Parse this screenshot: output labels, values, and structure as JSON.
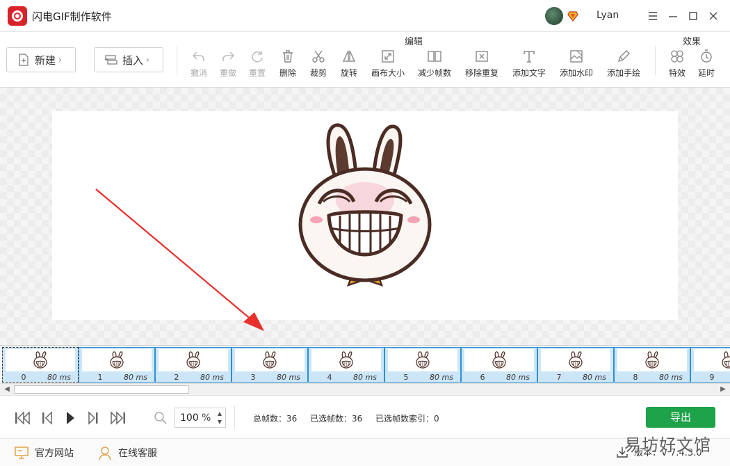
{
  "window": {
    "title": "闪电GIF制作软件",
    "username": "Lyan"
  },
  "toolbar": {
    "new_label": "新建",
    "insert_label": "插入",
    "edit_group_label": "编辑",
    "effects_group_label": "效果",
    "tools": [
      {
        "label": "撤消",
        "icon": "undo-icon",
        "enabled": false
      },
      {
        "label": "重做",
        "icon": "redo-icon",
        "enabled": false
      },
      {
        "label": "重置",
        "icon": "reset-icon",
        "enabled": false
      },
      {
        "label": "删除",
        "icon": "trash-icon",
        "enabled": true
      },
      {
        "label": "裁剪",
        "icon": "scissors-icon",
        "enabled": true
      },
      {
        "label": "旋转",
        "icon": "flip-icon",
        "enabled": true
      },
      {
        "label": "画布大小",
        "icon": "canvas-resize-icon",
        "enabled": true
      },
      {
        "label": "减少帧数",
        "icon": "reduce-frames-icon",
        "enabled": true
      },
      {
        "label": "移除重复",
        "icon": "remove-duplicate-icon",
        "enabled": true
      },
      {
        "label": "添加文字",
        "icon": "text-icon",
        "enabled": true
      },
      {
        "label": "添加水印",
        "icon": "watermark-icon",
        "enabled": true
      },
      {
        "label": "添加手绘",
        "icon": "pen-icon",
        "enabled": true
      }
    ],
    "effect_tools": [
      {
        "label": "特效",
        "icon": "effects-icon"
      },
      {
        "label": "延时",
        "icon": "timer-icon"
      }
    ]
  },
  "frames": [
    {
      "index": "0",
      "duration": "80 ms"
    },
    {
      "index": "1",
      "duration": "80 ms"
    },
    {
      "index": "2",
      "duration": "80 ms"
    },
    {
      "index": "3",
      "duration": "80 ms"
    },
    {
      "index": "4",
      "duration": "80 ms"
    },
    {
      "index": "5",
      "duration": "80 ms"
    },
    {
      "index": "6",
      "duration": "80 ms"
    },
    {
      "index": "7",
      "duration": "80 ms"
    },
    {
      "index": "8",
      "duration": "80 ms"
    },
    {
      "index": "9",
      "duration": ""
    }
  ],
  "playback": {
    "zoom_value": "100",
    "zoom_unit": "%",
    "total_frames_label": "总帧数：36",
    "selected_frames_label": "已选帧数：36",
    "selected_index_label": "已选帧数索引：0",
    "export_label": "导出"
  },
  "footer": {
    "website_label": "官方网站",
    "support_label": "在线客服",
    "version_label": "版本：V 7.4.3.0"
  },
  "watermark_text": "易坊好文馆",
  "colors": {
    "accent_red": "#d8232a",
    "export_green": "#1fa34a",
    "frame_selected": "#cde6f7",
    "frame_border": "#2b8fd6",
    "arrow_red": "#e8302c"
  }
}
